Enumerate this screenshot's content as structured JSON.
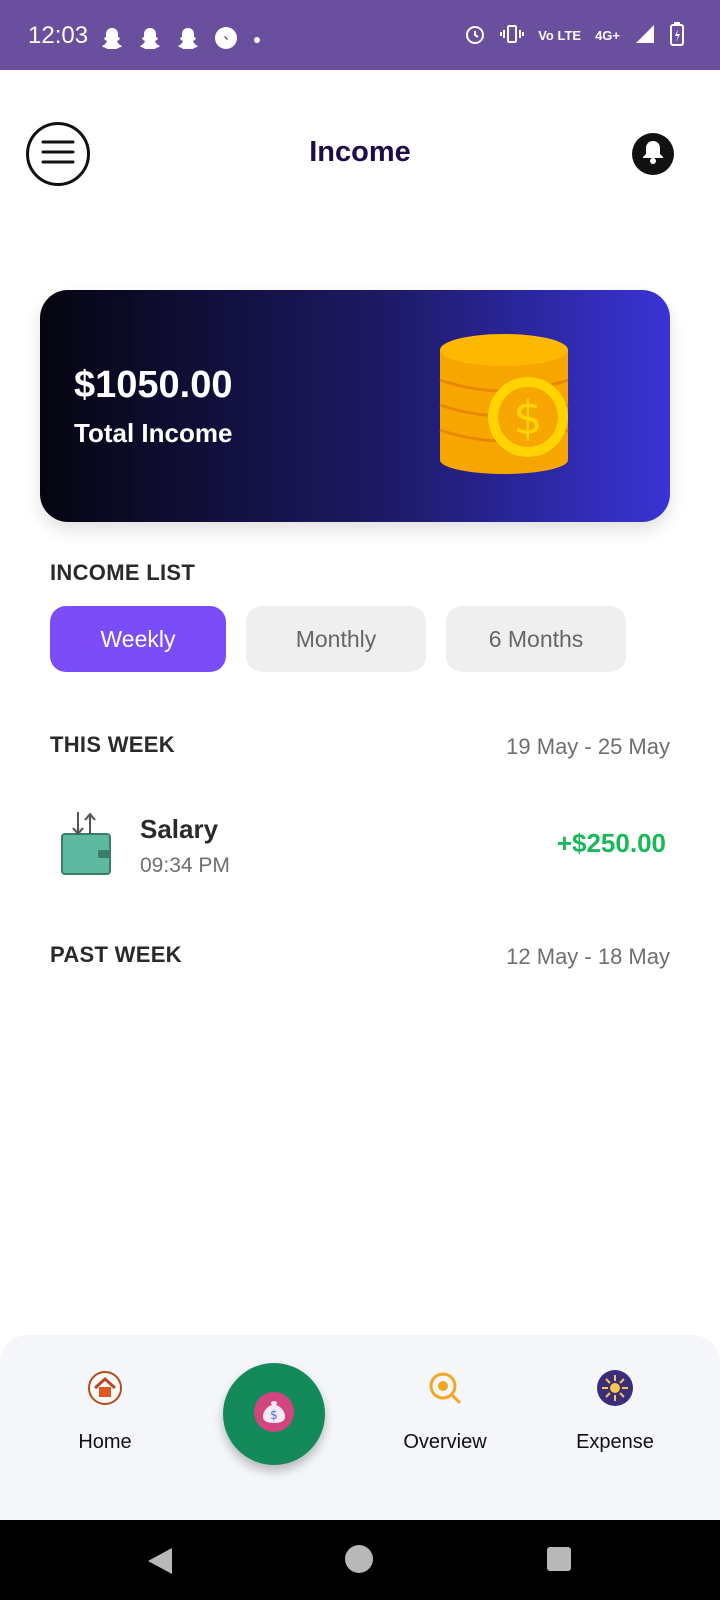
{
  "status_bar": {
    "time": "12:03",
    "notification_icons": [
      "snapchat-icon",
      "snapchat-icon",
      "snapchat-icon",
      "messenger-icon",
      "dot-icon"
    ],
    "network": "4G+",
    "volte": "Vo LTE"
  },
  "header": {
    "title": "Income",
    "menu_icon": "menu-icon",
    "bell_icon": "bell-icon"
  },
  "card": {
    "amount": "$1050.00",
    "label": "Total Income"
  },
  "income_list": {
    "heading": "INCOME LIST",
    "tabs": [
      {
        "label": "Weekly",
        "active": true
      },
      {
        "label": "Monthly",
        "active": false
      },
      {
        "label": "6 Months",
        "active": false
      }
    ]
  },
  "this_week": {
    "heading": "THIS WEEK",
    "range": "19 May - 25 May",
    "transactions": [
      {
        "title": "Salary",
        "time": "09:34 PM",
        "amount": "+$250.00",
        "icon": "wallet-icon"
      }
    ]
  },
  "past_week": {
    "heading": "PAST WEEK",
    "range": "12 May - 18 May"
  },
  "bottom_nav": {
    "home": "Home",
    "overview": "Overview",
    "expense": "Expense"
  },
  "colors": {
    "status_bar": "#6a4f9e",
    "title": "#1f0a4a",
    "active_tab": "#7b4df8",
    "income_amount": "#18b957",
    "fab": "#148a5a"
  }
}
